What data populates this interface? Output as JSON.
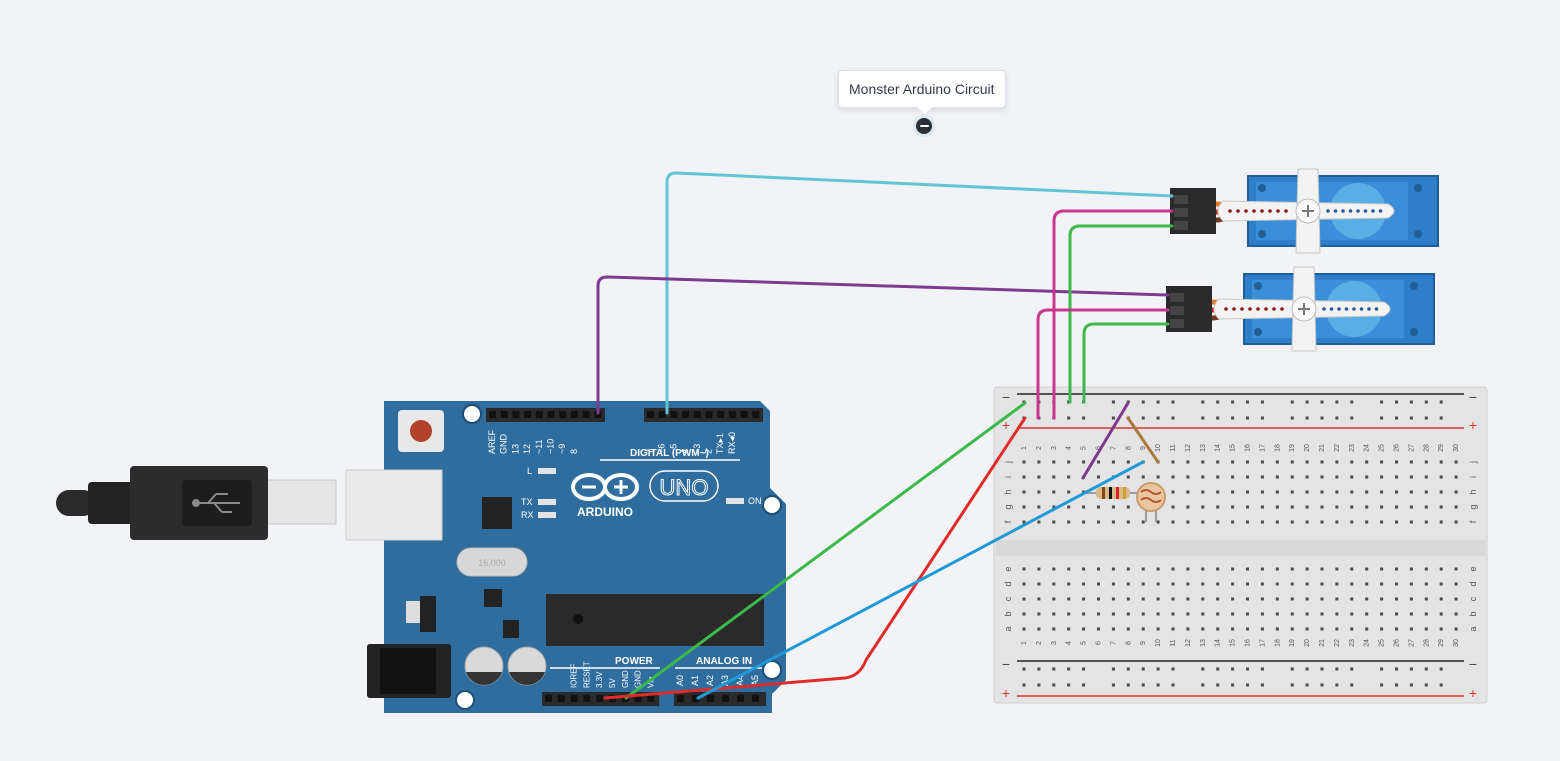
{
  "circuit": {
    "name": "Monster Arduino Circuit"
  },
  "arduino": {
    "brand": "ARDUINO",
    "model": "UNO",
    "on_label": "ON",
    "l_label": "L",
    "tx_label": "TX",
    "rx_label": "RX",
    "crystal_label": "16.000",
    "digital_header": "DIGITAL (PWM~)",
    "power_header": "POWER",
    "analog_header": "ANALOG IN",
    "digital_pins": [
      "AREF",
      "GND",
      "13",
      "12",
      "~11",
      "~10",
      "~9",
      "8",
      "7",
      "~6",
      "~5",
      "4",
      "~3",
      "2",
      "TX▸1",
      "RX◂0"
    ],
    "power_pins": [
      "IOREF",
      "RESET",
      "3.3V",
      "5V",
      "GND",
      "GND",
      "Vin"
    ],
    "analog_pins": [
      "A0",
      "A1",
      "A2",
      "A3",
      "A4",
      "A5"
    ]
  },
  "breadboard": {
    "row_letters_top": [
      "j",
      "i",
      "h",
      "g",
      "f"
    ],
    "row_letters_bottom": [
      "e",
      "d",
      "c",
      "b",
      "a"
    ],
    "column_numbers": [
      "1",
      "2",
      "3",
      "4",
      "5",
      "6",
      "7",
      "8",
      "9",
      "10",
      "11",
      "12",
      "13",
      "14",
      "15",
      "16",
      "17",
      "18",
      "19",
      "20",
      "21",
      "22",
      "23",
      "24",
      "25",
      "26",
      "27",
      "28",
      "29",
      "30"
    ],
    "rail_minus": "−",
    "rail_plus": "+"
  },
  "colors": {
    "board": "#2e6d9e",
    "wire_cyan": "#63c5d4",
    "wire_purple": "#7b3b8f",
    "wire_magenta": "#c8368f",
    "wire_green": "#3db84a",
    "wire_red": "#e02b2b",
    "wire_blue": "#1f9ad6",
    "servo": "#2f7fc8"
  }
}
